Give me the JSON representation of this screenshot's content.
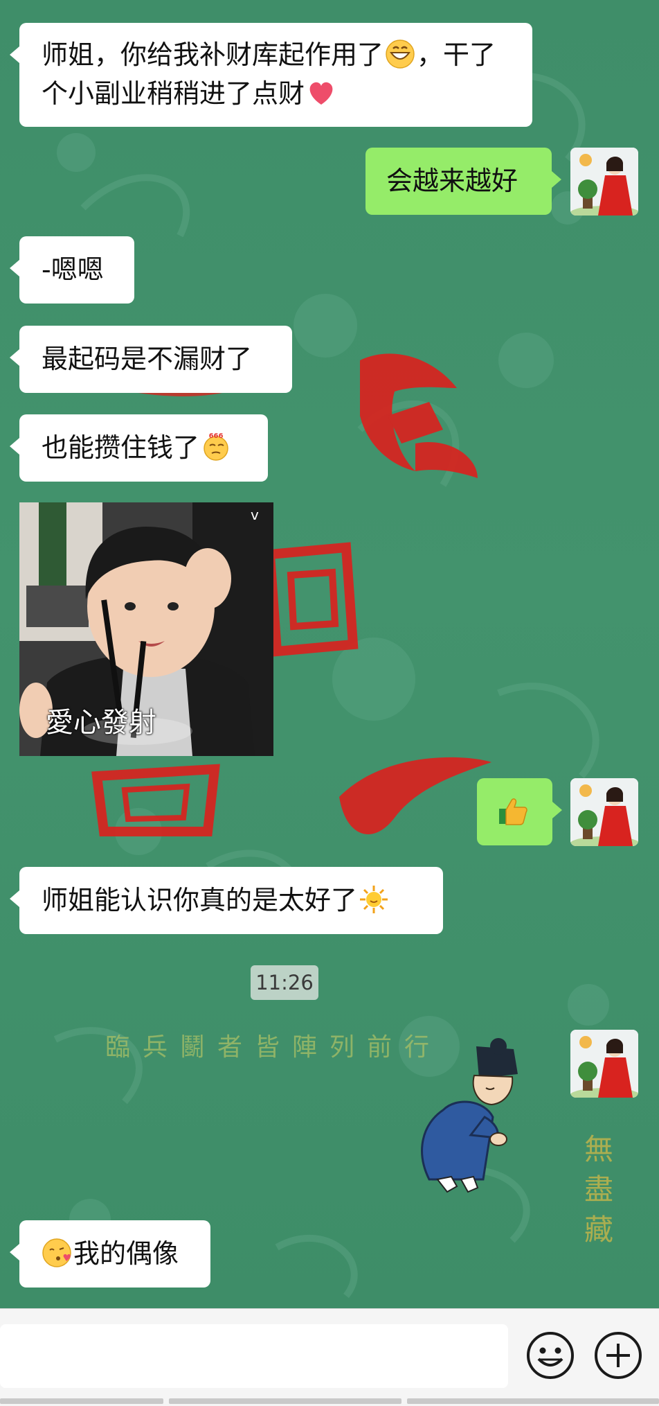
{
  "messages": {
    "m1": {
      "text_a": "师姐，你给我补财库起作用了",
      "text_b": "，干了个小副业稍稍进了点财"
    },
    "m2": {
      "text": "会越来越好"
    },
    "m3": {
      "text": "-嗯嗯"
    },
    "m4": {
      "text": "最起码是不漏财了"
    },
    "m5": {
      "text": "也能攒住钱了"
    },
    "m6": {
      "caption": "愛心發射",
      "corner_mark": "v"
    },
    "m7": {
      "text": "👍"
    },
    "m8": {
      "text": "师姐能认识你真的是太好了"
    },
    "time": "11:26",
    "m10": {
      "text": "我的偶像"
    }
  },
  "background": {
    "headline": "臨兵鬭者皆陣列前行",
    "seal": "無盡藏",
    "big_chars": [
      "飛",
      "回",
      "鳳"
    ]
  },
  "bottom_bar": {
    "input_placeholder": "",
    "emoji_button": "emoji-face",
    "add_button": "plus"
  },
  "colors": {
    "bg_green": "#3f8f69",
    "sent_bubble": "#95ec69",
    "received_bubble": "#ffffff",
    "accent_red": "#d8231f"
  }
}
